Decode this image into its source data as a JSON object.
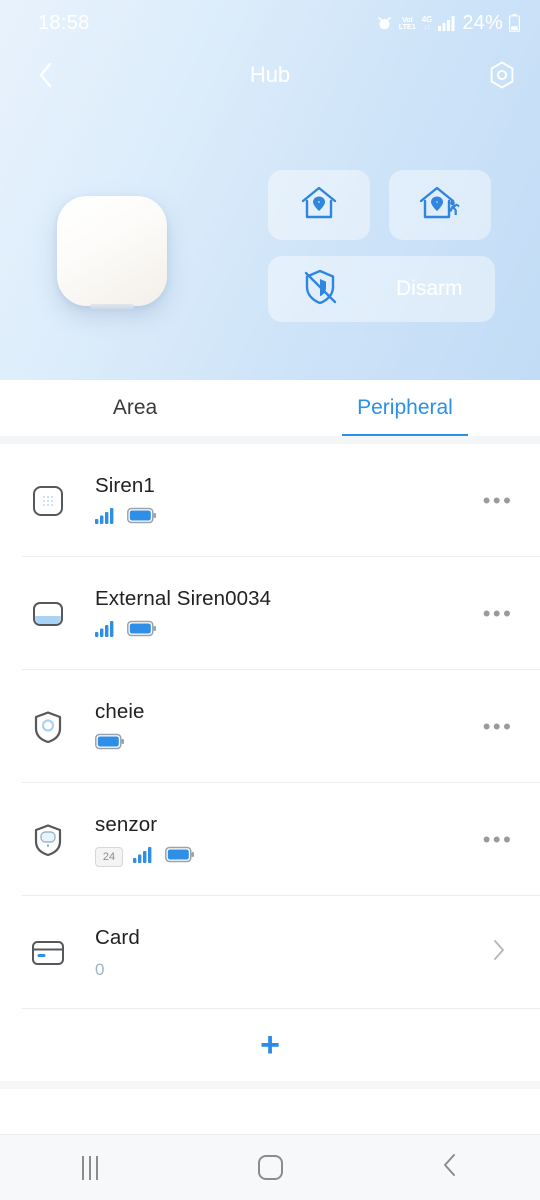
{
  "status_bar": {
    "time": "18:58",
    "alarm_icon": "alarm-clock-icon",
    "volte_line1": "VoI",
    "volte_line2": "LTE1",
    "network_type": "4G",
    "data_arrows": "↓↑",
    "signal_icon": "cellular-signal-icon",
    "battery_percent": "24%",
    "battery_icon": "battery-icon"
  },
  "header": {
    "back_icon": "chevron-left-icon",
    "title": "Hub",
    "settings_icon": "gear-icon",
    "device_icon": "hub-device-image",
    "accent_color": "#2a90e8",
    "hero_gradient_from": "#e8f2fc",
    "hero_gradient_to": "#c2dcf6"
  },
  "modes": [
    {
      "name": "arm-stay-button",
      "icon": "home-shield-icon",
      "label": ""
    },
    {
      "name": "arm-away-button",
      "icon": "home-running-person-icon",
      "label": ""
    },
    {
      "name": "disarm-button",
      "icon": "shield-slash-icon",
      "label": "Disarm"
    }
  ],
  "tabs": [
    {
      "label": "Area",
      "active": false
    },
    {
      "label": "Peripheral",
      "active": true
    }
  ],
  "peripherals": [
    {
      "name": "Siren1",
      "icon": "siren-grid-icon",
      "badge": "",
      "signal": true,
      "battery": true,
      "subtitle": "",
      "action": "more-options"
    },
    {
      "name": "External Siren0034",
      "icon": "external-siren-icon",
      "badge": "",
      "signal": true,
      "battery": true,
      "subtitle": "",
      "action": "more-options"
    },
    {
      "name": "cheie",
      "icon": "keyfob-shield-icon",
      "badge": "",
      "signal": false,
      "battery": true,
      "subtitle": "",
      "action": "more-options"
    },
    {
      "name": "senzor",
      "icon": "motion-sensor-shield-icon",
      "badge": "24",
      "signal": true,
      "battery": true,
      "subtitle": "",
      "action": "more-options"
    },
    {
      "name": "Card",
      "icon": "card-icon",
      "badge": "",
      "signal": false,
      "battery": false,
      "subtitle": "0",
      "action": "chevron"
    }
  ],
  "add_button": {
    "label": "+"
  },
  "android_nav": {
    "recents_icon": "recents-icon",
    "home_icon": "home-icon",
    "back_icon": "back-chevron-icon"
  }
}
